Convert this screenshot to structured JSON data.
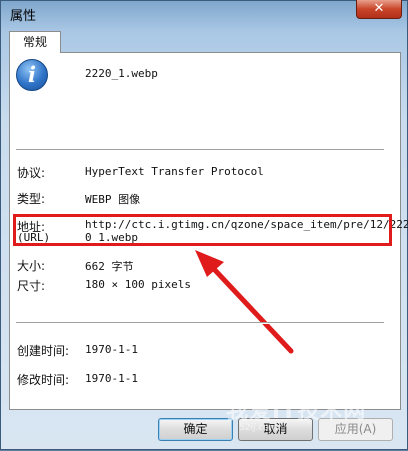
{
  "window": {
    "title": "属性",
    "close_symbol": "✕"
  },
  "tab": {
    "label": "常规"
  },
  "file": {
    "name": "2220_1.webp",
    "icon": "info-icon"
  },
  "properties": {
    "protocol": {
      "label": "协议:",
      "value": "HyperText Transfer Protocol"
    },
    "type": {
      "label": "类型:",
      "value": "WEBP 图像"
    },
    "address": {
      "label": "地址:",
      "label_sub": "(URL)",
      "value_line1": "http://ctc.i.gtimg.cn/qzone/space_item/pre/12/222",
      "value_line2": "0_1.webp"
    },
    "size": {
      "label": "大小:",
      "value": "662 字节"
    },
    "dimensions": {
      "label": "尺寸:",
      "value": "180 × 100 pixels"
    },
    "created": {
      "label": "创建时间:",
      "value": "1970-1-1"
    },
    "modified": {
      "label": "修改时间:",
      "value": "1970-1-1"
    }
  },
  "buttons": {
    "ok": "确定",
    "cancel": "取消",
    "apply": "应用(A)"
  },
  "watermark": {
    "text": "我爱IT技术网",
    "sub": "52ij.com"
  },
  "colors": {
    "annotation_red": "#e01b1b"
  }
}
